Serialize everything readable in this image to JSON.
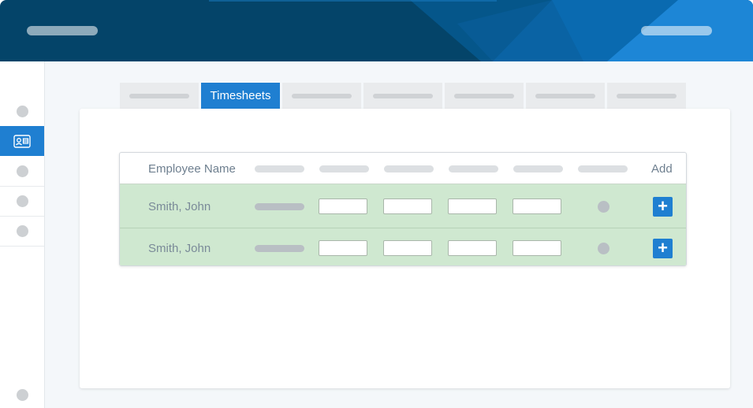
{
  "tabs": [
    {
      "label": "",
      "active": false
    },
    {
      "label": "Timesheets",
      "active": true
    },
    {
      "label": "",
      "active": false
    },
    {
      "label": "",
      "active": false
    },
    {
      "label": "",
      "active": false
    },
    {
      "label": "",
      "active": false
    },
    {
      "label": "",
      "active": false
    }
  ],
  "table": {
    "headers": {
      "employee_name": "Employee Name",
      "add": "Add"
    },
    "rows": [
      {
        "name": "Smith, John",
        "add_symbol": "+"
      },
      {
        "name": "Smith, John",
        "add_symbol": "+"
      }
    ]
  },
  "colors": {
    "header_dark": "#044469",
    "accent_blue": "#1f7fd1",
    "row_green": "#cfe8d0"
  },
  "icons": {
    "sidebar_active": "id-card-icon",
    "add": "plus-icon"
  }
}
